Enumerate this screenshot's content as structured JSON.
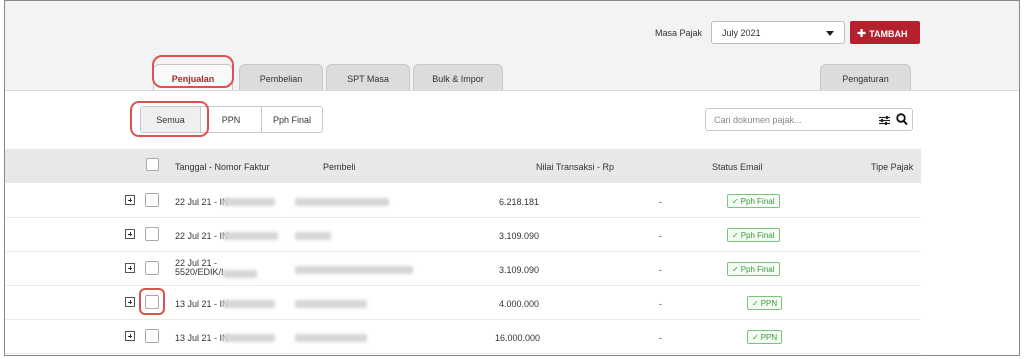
{
  "header": {
    "masa_pajak_label": "Masa Pajak",
    "period_value": "July  2021",
    "add_button_label": "TAMBAH",
    "add_button_icon": "plus-icon"
  },
  "tabs": [
    {
      "label": "Penjualan",
      "active": true
    },
    {
      "label": "Pembelian",
      "active": false
    },
    {
      "label": "SPT Masa",
      "active": false
    },
    {
      "label": "Bulk & Impor",
      "active": false
    },
    {
      "label": "Pengaturan",
      "active": false
    }
  ],
  "filters": [
    {
      "label": "Semua",
      "active": true
    },
    {
      "label": "PPN",
      "active": false
    },
    {
      "label": "Pph Final",
      "active": false
    }
  ],
  "search": {
    "placeholder": "Cari dokumen pajak..."
  },
  "table": {
    "columns": [
      "Tanggal - Nomor Faktur",
      "Pembeli",
      "Nilai Transaksi - Rp",
      "Status Email",
      "Tipe Pajak"
    ],
    "rows": [
      {
        "tanggal": "22 Jul 21 - IN",
        "nilai": "6.218.181",
        "status_email": "-",
        "tipe_pajak": "Pph Final"
      },
      {
        "tanggal": "22 Jul 21 - IN",
        "nilai": "3.109.090",
        "status_email": "-",
        "tipe_pajak": "Pph Final"
      },
      {
        "tanggal": "22 Jul 21 - 5520/EDIK/I",
        "nilai": "3.109.090",
        "status_email": "-",
        "tipe_pajak": "Pph Final"
      },
      {
        "tanggal": "13 Jul 21 - IN",
        "nilai": "4.000.000",
        "status_email": "-",
        "tipe_pajak": "PPN"
      },
      {
        "tanggal": "13 Jul 21 - IN",
        "nilai": "16.000.000",
        "status_email": "-",
        "tipe_pajak": "PPN"
      }
    ]
  },
  "colors": {
    "brand_red": "#b3212d",
    "highlight": "#d9534f",
    "badge_green": "#3f9a3f"
  }
}
